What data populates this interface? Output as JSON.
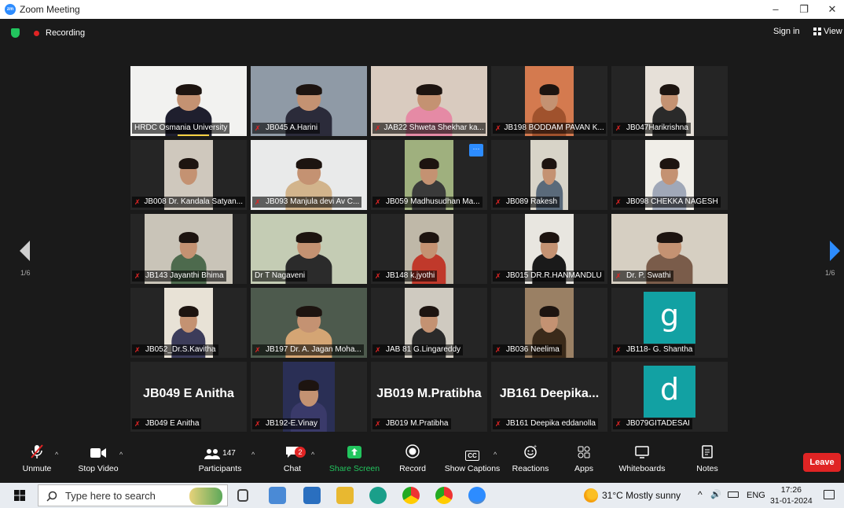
{
  "window": {
    "title": "Zoom Meeting",
    "minimize": "–",
    "restore": "❐",
    "close": "✕"
  },
  "meeting": {
    "recording_label": "Recording",
    "sign_in": "Sign in",
    "view_label": "View"
  },
  "pagination": {
    "left": "1/6",
    "right": "1/6"
  },
  "participants": [
    {
      "name": "HRDC Osmania University",
      "muted": false,
      "video": true,
      "bg": "#f2f2f0",
      "shirt": "#1f1f2e",
      "pw": 148,
      "speaker_bar": true
    },
    {
      "name": "JB045 A.Harini",
      "muted": true,
      "video": true,
      "bg": "#8f9aa6",
      "shirt": "#2b2b3a",
      "pw": 148
    },
    {
      "name": "JAB22 Shweta Shekhar ka...",
      "muted": true,
      "video": true,
      "bg": "#d9cbbf",
      "shirt": "#e58aa5",
      "pw": 148
    },
    {
      "name": "JB198 BODDAM PAVAN K...",
      "muted": true,
      "video": true,
      "bg": "#d47a4f",
      "shirt": "#a0522d",
      "pw": 62
    },
    {
      "name": "JB047Harikrishna",
      "muted": true,
      "video": true,
      "bg": "#e6e0d8",
      "shirt": "#2a2a2a",
      "pw": 62
    },
    {
      "name": "JB008 Dr. Kandala Satyan...",
      "muted": true,
      "video": true,
      "bg": "#cfc8bd",
      "shirt": "#cfc8bd",
      "pw": 62
    },
    {
      "name": "JB093 Manjula devi Av C...",
      "muted": true,
      "video": true,
      "bg": "#e9eaea",
      "shirt": "#d2b48c",
      "pw": 148
    },
    {
      "name": "JB059 Madhusudhan Ma...",
      "muted": true,
      "video": true,
      "bg": "#9fb07e",
      "shirt": "#3a3a3a",
      "pw": 62,
      "more": true
    },
    {
      "name": "JB089 Rakesh",
      "muted": true,
      "video": true,
      "bg": "#d8d4c8",
      "shirt": "#5a6a7a",
      "pw": 48
    },
    {
      "name": "JB098 CHEKKA NAGESH",
      "muted": true,
      "video": true,
      "bg": "#f0eee8",
      "shirt": "#a0a8b8",
      "pw": 62
    },
    {
      "name": "JB143 Jayanthi Bhima",
      "muted": true,
      "video": true,
      "bg": "#c9c4b8",
      "shirt": "#4d6a4d",
      "pw": 112
    },
    {
      "name": "Dr T Nagaveni",
      "muted": false,
      "video": true,
      "bg": "#c4ccb4",
      "shirt": "#2b2b2b",
      "pw": 148,
      "active": true
    },
    {
      "name": "JB148 k.jyothi",
      "muted": true,
      "video": true,
      "bg": "#bfb8a8",
      "shirt": "#c0392b",
      "pw": 62
    },
    {
      "name": "JB015 DR.R.HANMANDLU",
      "muted": true,
      "video": true,
      "bg": "#e8e6e0",
      "shirt": "#1a1a1a",
      "pw": 62
    },
    {
      "name": "Dr. P. Swathi",
      "muted": true,
      "video": true,
      "bg": "#d6cfc2",
      "shirt": "#7a5c4a",
      "pw": 148
    },
    {
      "name": "JB052_Dr.S.Kavitha",
      "muted": true,
      "video": true,
      "bg": "#e8e2d6",
      "shirt": "#3c3c5a",
      "pw": 62
    },
    {
      "name": "JB197 Dr. A. Jagan Moha...",
      "muted": true,
      "video": true,
      "bg": "#4d5a4d",
      "shirt": "#d4a574",
      "pw": 148
    },
    {
      "name": "JAB 81 G.Lingareddy",
      "muted": true,
      "video": true,
      "bg": "#cfcac0",
      "shirt": "#2a2a2a",
      "pw": 62
    },
    {
      "name": "JB036 Neelima",
      "muted": true,
      "video": true,
      "bg": "#9a8064",
      "shirt": "#3a2a1a",
      "pw": 62
    },
    {
      "name": "JB118- G. Shantha",
      "muted": true,
      "video": false,
      "avatar": "g"
    },
    {
      "name": "JB049 E Anitha",
      "muted": true,
      "video": false,
      "big": "JB049 E Anitha"
    },
    {
      "name": "JB192-E.Vinay",
      "muted": true,
      "video": true,
      "bg": "#2a2f55",
      "shirt": "#3a3a6a",
      "pw": 66
    },
    {
      "name": "JB019 M.Pratibha",
      "muted": true,
      "video": false,
      "big": "JB019 M.Pratibha"
    },
    {
      "name": "JB161 Deepika eddanolla",
      "muted": true,
      "video": false,
      "big": "JB161  Deepika..."
    },
    {
      "name": "JB079GITADESAI",
      "muted": true,
      "video": false,
      "avatar": "d"
    }
  ],
  "toolbar": {
    "unmute": "Unmute",
    "stop_video": "Stop Video",
    "participants": "Participants",
    "participant_count": "147",
    "chat": "Chat",
    "chat_badge": "2",
    "share_screen": "Share Screen",
    "record": "Record",
    "show_captions": "Show Captions",
    "reactions": "Reactions",
    "apps": "Apps",
    "whiteboards": "Whiteboards",
    "notes": "Notes",
    "leave": "Leave",
    "cc": "CC"
  },
  "taskbar": {
    "search_placeholder": "Type here to search",
    "weather": "31°C  Mostly sunny",
    "language": "ENG",
    "time": "17:26",
    "date": "31-01-2024"
  },
  "colors": {
    "accent": "#2d8cff",
    "leave": "#e02424",
    "share": "#22c55e",
    "active_speaker": "#c4e04a",
    "avatar": "#12a1a3"
  }
}
